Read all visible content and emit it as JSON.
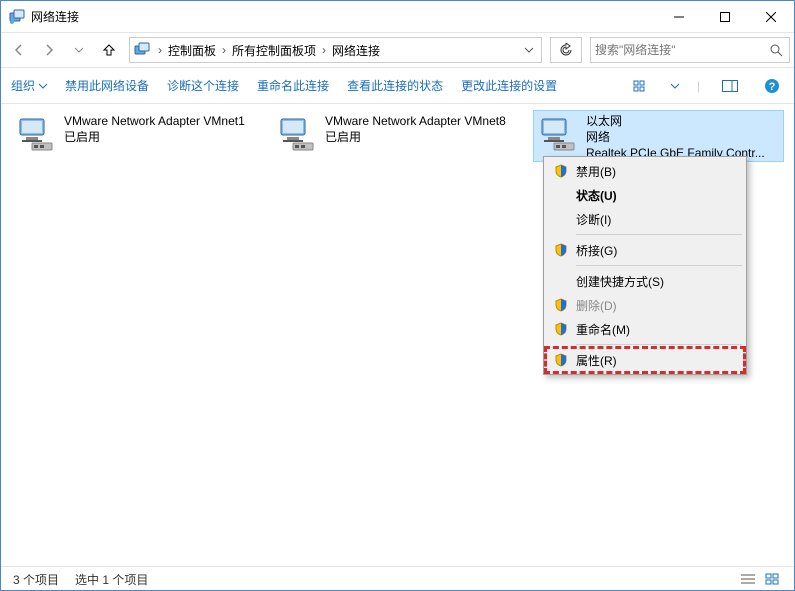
{
  "window": {
    "title": "网络连接"
  },
  "breadcrumbs": [
    "控制面板",
    "所有控制面板项",
    "网络连接"
  ],
  "search": {
    "placeholder": "搜索\"网络连接\""
  },
  "toolbar": {
    "organize": "组织",
    "disable": "禁用此网络设备",
    "diagnose": "诊断这个连接",
    "rename": "重命名此连接",
    "status": "查看此连接的状态",
    "settings": "更改此连接的设置"
  },
  "adapters": [
    {
      "name": "VMware Network Adapter VMnet1",
      "status": "已启用",
      "detail": ""
    },
    {
      "name": "VMware Network Adapter VMnet8",
      "status": "已启用",
      "detail": ""
    },
    {
      "name": "以太网",
      "status": "网络",
      "detail": "Realtek PCIe GbE Family Contr..."
    }
  ],
  "context_menu": {
    "disable": "禁用(B)",
    "status_bold": "状态(U)",
    "diagnose": "诊断(I)",
    "bridge": "桥接(G)",
    "shortcut": "创建快捷方式(S)",
    "delete": "删除(D)",
    "rename": "重命名(M)",
    "properties": "属性(R)"
  },
  "statusbar": {
    "count": "3 个项目",
    "selected": "选中 1 个项目"
  }
}
